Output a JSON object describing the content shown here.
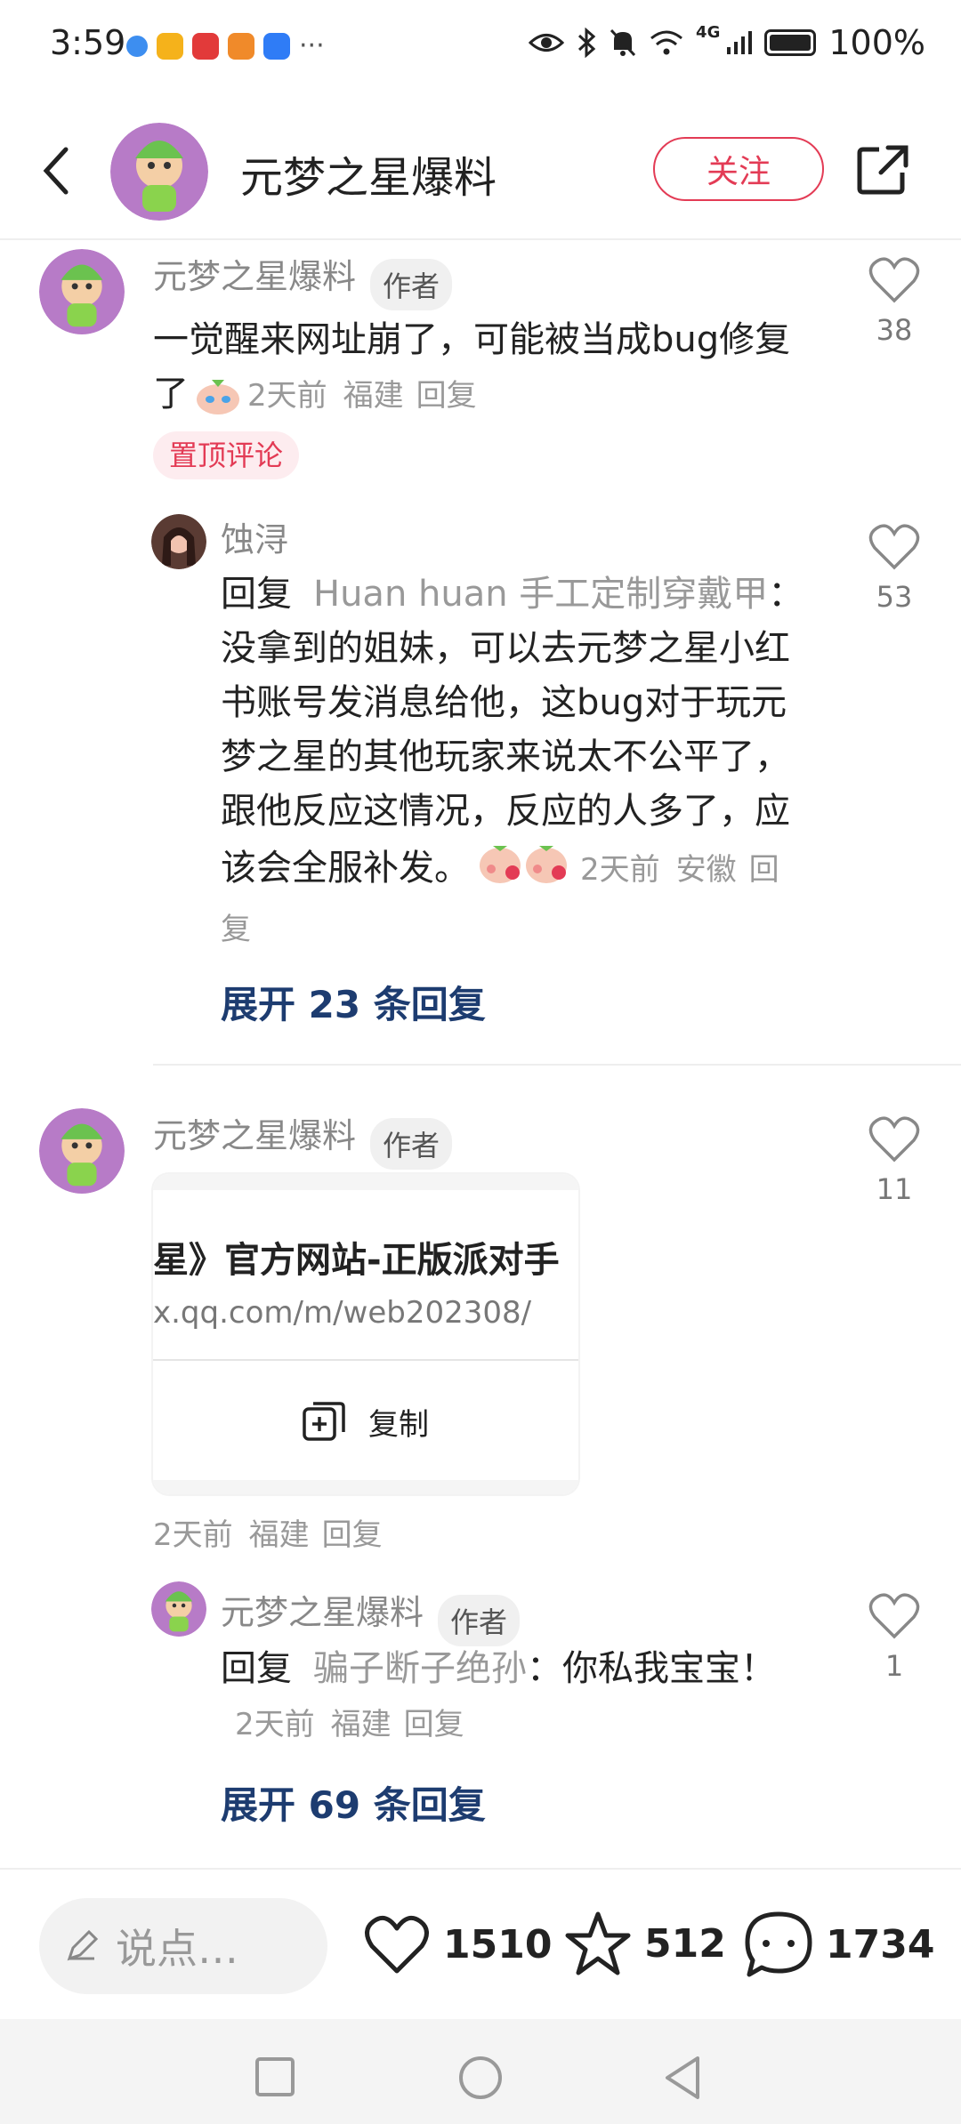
{
  "status_bar": {
    "time": "3:59",
    "more": "···",
    "network": "4G",
    "battery": "100%",
    "app_colors": [
      "#3d8ef0",
      "#f5b21b",
      "#e23a3a",
      "#f08a2a",
      "#2f7cf6"
    ]
  },
  "header": {
    "title": "元梦之星爆料",
    "follow_label": "关注"
  },
  "comments": [
    {
      "author": "元梦之星爆料",
      "badge": "作者",
      "text": "一觉醒来网址崩了，可能被当成bug修复了",
      "time": "2天前",
      "location": "福建",
      "reply_label": "回复",
      "pinned_label": "置顶评论",
      "likes": "38",
      "reply": {
        "author": "蚀浔",
        "prefix": "回复",
        "target": "Huan huan 手工定制穿戴甲",
        "text": "：没拿到的姐妹，可以去元梦之星小红书账号发消息给他，这bug对于玩元梦之星的其他玩家来说太不公平了，跟他反应这情况，反应的人多了，应该会全服补发。",
        "time": "2天前",
        "location": "安徽",
        "reply_label": "回复",
        "likes": "53"
      },
      "expand": "展开 23 条回复"
    },
    {
      "author": "元梦之星爆料",
      "badge": "作者",
      "card_title": "星》官方网站-正版派对手",
      "card_url": "x.qq.com/m/web202308/",
      "copy_label": "复制",
      "time": "2天前",
      "location": "福建",
      "reply_label": "回复",
      "likes": "11",
      "reply": {
        "author": "元梦之星爆料",
        "badge": "作者",
        "prefix": "回复",
        "target": "骗子断子绝孙",
        "text": "：你私我宝宝！",
        "time": "2天前",
        "location": "福建",
        "reply_label": "回复",
        "likes": "1"
      },
      "expand": "展开 69 条回复"
    }
  ],
  "bottom_bar": {
    "input_placeholder": "说点…",
    "likes": "1510",
    "favorites": "512",
    "comments": "1734"
  },
  "colors": {
    "accent": "#e33b55",
    "link": "#1d3c70"
  }
}
